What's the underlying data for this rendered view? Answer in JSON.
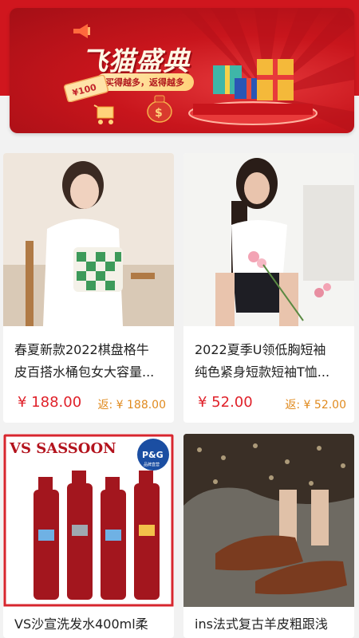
{
  "banner": {
    "title": "飞猫盛典",
    "subtitle": "买得越多，返得越多",
    "coupon_text": "¥100",
    "colors": {
      "primary": "#d0161e",
      "accent": "#ffd27a"
    }
  },
  "products": [
    {
      "title_line1": "春夏新款2022棋盘格牛",
      "title_line2": "皮百搭水桶包女大容量...",
      "price": "¥ 188.00",
      "rebate": "返: ¥ 188.00",
      "image": "woman-with-checkered-bag"
    },
    {
      "title_line1": "2022夏季U领低胸短袖",
      "title_line2": "纯色紧身短款短袖T恤...",
      "price": "¥ 52.00",
      "rebate": "返: ¥ 52.00",
      "image": "woman-in-white-crop-top-with-roses"
    },
    {
      "title_line1": "VS沙宣洗发水400ml柔",
      "image": "vs-shampoo-bottles",
      "brand_logo": "VS SASSOON",
      "badge": "P&G",
      "badge_sub": "品牌直营"
    },
    {
      "title_line1": "ins法式复古羊皮粗跟浅",
      "image": "brown-leather-shoes"
    }
  ]
}
